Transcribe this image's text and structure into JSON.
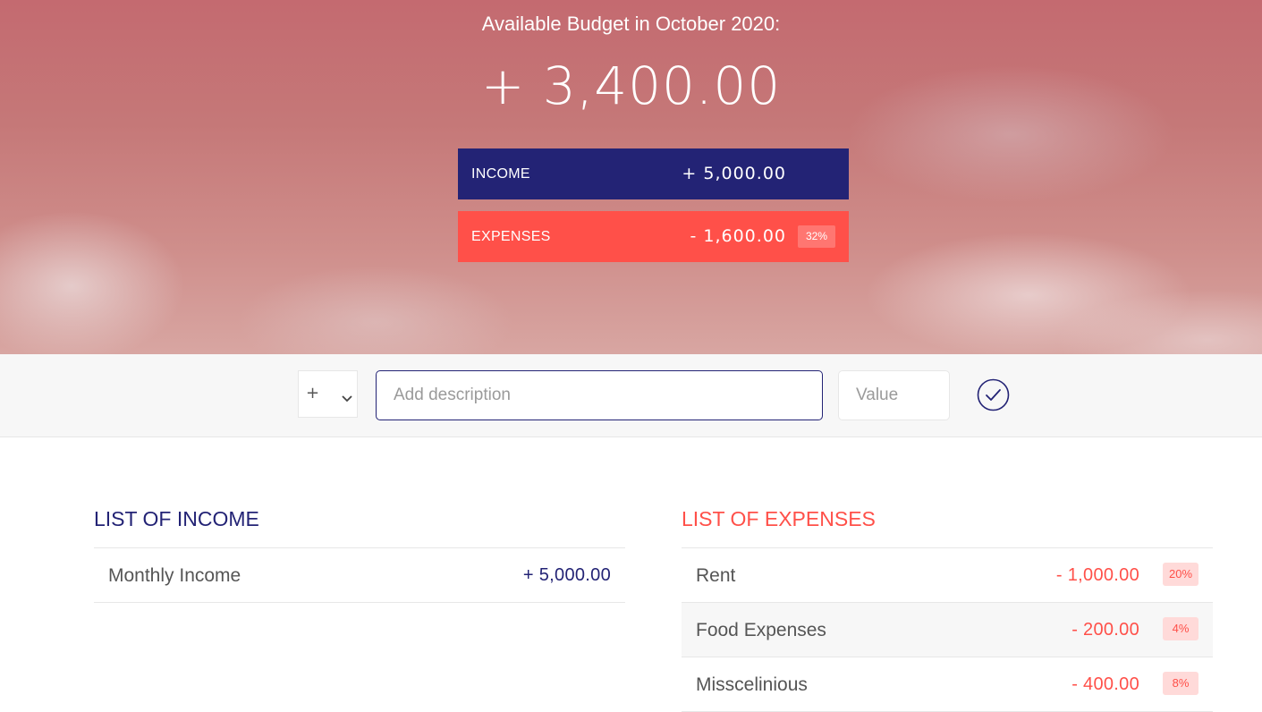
{
  "header": {
    "title": "Available Budget in October 2020:",
    "budget": "+ 3,400.00",
    "income": {
      "label": "INCOME",
      "value": "+ 5,000.00"
    },
    "expenses": {
      "label": "EXPENSES",
      "value": "- 1,600.00",
      "percentage": "32%"
    }
  },
  "add_bar": {
    "type_options": [
      "+"
    ],
    "type_selected": "+",
    "description_placeholder": "Add description",
    "value_placeholder": "Value",
    "submit_icon": "check-circle-icon"
  },
  "income_list": {
    "title": "LIST OF INCOME",
    "items": [
      {
        "description": "Monthly Income",
        "value": "+ 5,000.00"
      }
    ]
  },
  "expenses_list": {
    "title": "LIST OF EXPENSES",
    "items": [
      {
        "description": "Rent",
        "value": "- 1,000.00",
        "percentage": "20%"
      },
      {
        "description": "Food Expenses",
        "value": "- 200.00",
        "percentage": "4%"
      },
      {
        "description": "Misscelinious",
        "value": "- 400.00",
        "percentage": "8%"
      }
    ]
  },
  "colors": {
    "income": "#232375",
    "expenses": "#ff5049",
    "percentage_badge": "#ffdad9"
  }
}
